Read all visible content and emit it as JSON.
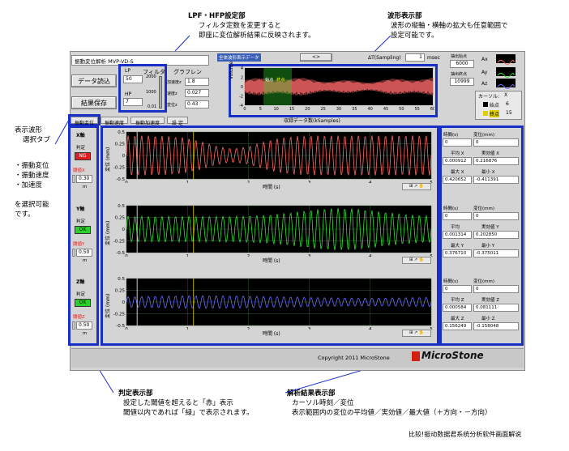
{
  "annotations": {
    "filter_title": "LPF・HFP設定部",
    "filter_desc1": "フィルタ定数を変更すると",
    "filter_desc2": "即座に変位解析結果に反映されます。",
    "waveform_title": "波形表示部",
    "waveform_desc1": "波形の縦軸・横軸の拡大も任意範囲で",
    "waveform_desc2": "設定可能です。",
    "tab_title1": "表示波形",
    "tab_title2": "選択タブ",
    "tab_item1": "・振動変位",
    "tab_item2": "・振動速度",
    "tab_item3": "・加速度",
    "tab_note1": "を選択可能",
    "tab_note2": "です。",
    "judge_title": "判定表示部",
    "judge_desc1": "設定した閾値を超えると「赤」表示",
    "judge_desc2": "閾値以内であれば「緑」で表示されます。",
    "analysis_title": "解析結果表示部",
    "analysis_desc1": "カーソル時刻／変位",
    "analysis_desc2": "表示範囲内の変位の平均値／実効値／最大値（＋方向・－方向）",
    "footer": "比较!振动数据君系统分析软件画面解说"
  },
  "app": {
    "title": "振動変位解析 MVP-VD-S",
    "read_button": "データ読込",
    "save_button": "結果保存",
    "lp_label": "LP",
    "hp_label": "HP",
    "filter_label": "フィルタ",
    "gravity_label": "グラフレン",
    "lp_value": "50",
    "hp_value": "7",
    "slider_top": "2000",
    "slider_mid": "1000",
    "slider_bot": "0.01",
    "accel_label": "加速度z",
    "accel_value": "1.8",
    "vel_label": "速度z",
    "vel_value": "0.027",
    "disp_label": "変位z",
    "disp_value": "0.43",
    "overview_tab": "全体波形表示データ",
    "dt_label": "ΔT(Sampling)",
    "dt_value": "1",
    "dt_unit": "msec",
    "extract_start_label": "抽出始点",
    "extract_start_value": "6000",
    "extract_end_label": "抽出終点",
    "extract_end_value": "10999",
    "legend_ax": "Ax",
    "legend_ay": "Ay",
    "legend_az": "Az",
    "cursor_label": "カーソル:",
    "cursor_axis": "X",
    "cursor_start_label": "始点",
    "cursor_start_value": "6",
    "cursor_end_label": "終点",
    "cursor_end_value": "15",
    "overview_xlabel": "収録データ数(kSamples)",
    "overview_ylabel": "Volume",
    "overview_cursor_start": "始点",
    "overview_cursor_end": "終点",
    "tabs": [
      "振動変位",
      "振動速度",
      "振動加速度",
      "設 定"
    ],
    "copyright": "Copyright 2011 MicroStone",
    "brand": "MicroStone"
  },
  "axes_panels": [
    {
      "axis": "X軸",
      "judge_label": "判定",
      "judge": "NG",
      "threshold_label": "閾値X",
      "threshold": "0.30",
      "unit": "m"
    },
    {
      "axis": "Y軸",
      "judge_label": "判定",
      "judge": "OK",
      "threshold_label": "閾値Y",
      "threshold": "0.50",
      "unit": "m"
    },
    {
      "axis": "Z軸",
      "judge_label": "判定",
      "judge": "OK",
      "threshold_label": "閾値Z",
      "threshold": "0.50",
      "unit": "m"
    }
  ],
  "charts": [
    {
      "ylabel": "変位 (mm)",
      "xlabel": "時間 (s)",
      "color": "#ff6a6a"
    },
    {
      "ylabel": "変位 (mm)",
      "xlabel": "時間 (s)",
      "color": "#2fe02f"
    },
    {
      "ylabel": "変位 (mm)",
      "xlabel": "時間 (s)",
      "color": "#6a6aff"
    }
  ],
  "chart_yticks": [
    "0.5",
    "0.25",
    "0",
    "-0.25",
    "-0.5"
  ],
  "chart_xticks": [
    "0",
    "1",
    "2",
    "3",
    "4",
    "5"
  ],
  "overview_yticks": [
    "4",
    "2",
    "0",
    "-2",
    "-4"
  ],
  "overview_xticks": [
    "0",
    "5",
    "10",
    "15",
    "20",
    "25",
    "30",
    "35",
    "40",
    "45",
    "50",
    "55",
    "60"
  ],
  "results": [
    {
      "time_label": "時間(s)",
      "disp_label": "変位(mm)",
      "time": "0",
      "disp": "0",
      "avg_label": "平均 X",
      "rms_label": "実効値 X",
      "avg": "0.000912",
      "rms": "0.216876",
      "max_label": "最大 X",
      "min_label": "最小 X",
      "max": "0.420652",
      "min": "-0.411391"
    },
    {
      "time_label": "時間(s)",
      "disp_label": "変位(mm)",
      "time": "0",
      "disp": "0",
      "avg_label": "平均",
      "rms_label": "実効値 Y",
      "avg": "0.001314",
      "rms": "0.202850",
      "max_label": "最大 Y",
      "min_label": "最小 Y",
      "max": "0.376710",
      "min": "-0.375011"
    },
    {
      "time_label": "時間(s)",
      "disp_label": "変位(mm)",
      "time": "0",
      "disp": "0",
      "avg_label": "平均 Z",
      "rms_label": "実効値 Z",
      "avg": "0.000584",
      "rms": "0.081111",
      "max_label": "最大 Z",
      "min_label": "最小 Z",
      "max": "0.156249",
      "min": "-0.158048"
    }
  ]
}
